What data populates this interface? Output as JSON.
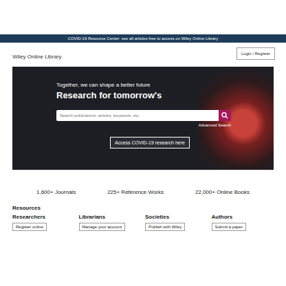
{
  "banner": {
    "text": "COVID-19 Resource Center: see all articles free to access on Wiley Online Library"
  },
  "header": {
    "logo": "Wiley Online Library",
    "login": "Login / Register"
  },
  "hero": {
    "headings": [
      "Together, we can shape a better future",
      "Research for tomorrow's"
    ],
    "search": {
      "placeholder": "Search publications, articles, keywords, etc."
    },
    "advanced": "Advanced Search",
    "cta": "Access COVID-19 research here"
  },
  "stats": [
    "1,600+ Journals",
    "225+ Reference Works",
    "22,000+ Online Books"
  ],
  "resources": {
    "title": "Resources",
    "columns": [
      {
        "heading": "Researchers",
        "link": "Register online"
      },
      {
        "heading": "Librarians",
        "link": "Manage your account"
      },
      {
        "heading": "Societies",
        "link": "Publish with Wiley"
      },
      {
        "heading": "Authors",
        "link": "Submit a paper"
      }
    ]
  }
}
